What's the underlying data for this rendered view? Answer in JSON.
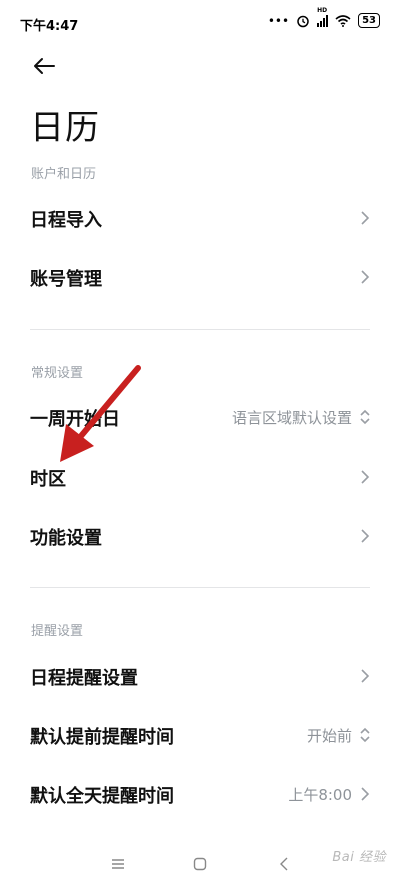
{
  "status": {
    "time": "下午4:47",
    "dots": "•••",
    "hd": "HD",
    "battery": "53"
  },
  "page": {
    "title": "日历"
  },
  "sections": [
    {
      "header": "账户和日历",
      "items": [
        {
          "label": "日程导入"
        },
        {
          "label": "账号管理"
        }
      ]
    },
    {
      "header": "常规设置",
      "items": [
        {
          "label": "一周开始日",
          "value": "语言区域默认设置"
        },
        {
          "label": "时区"
        },
        {
          "label": "功能设置"
        }
      ]
    },
    {
      "header": "提醒设置",
      "items": [
        {
          "label": "日程提醒设置"
        },
        {
          "label": "默认提前提醒时间",
          "value": "开始前"
        },
        {
          "label": "默认全天提醒时间",
          "value": "上午8:00"
        }
      ]
    }
  ],
  "watermark": "Bai 经验",
  "colors": {
    "accent_arrow": "#c8201f",
    "muted_text": "#8e9399",
    "header_text": "#9aa0a8"
  }
}
